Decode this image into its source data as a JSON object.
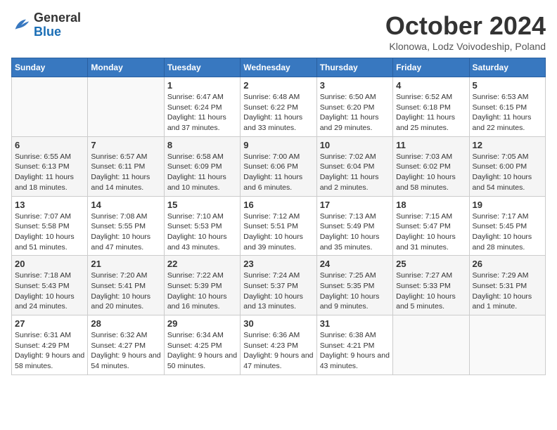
{
  "header": {
    "logo_general": "General",
    "logo_blue": "Blue",
    "month_title": "October 2024",
    "location": "Klonowa, Lodz Voivodeship, Poland"
  },
  "weekdays": [
    "Sunday",
    "Monday",
    "Tuesday",
    "Wednesday",
    "Thursday",
    "Friday",
    "Saturday"
  ],
  "weeks": [
    [
      {
        "day": "",
        "sunrise": "",
        "sunset": "",
        "daylight": ""
      },
      {
        "day": "",
        "sunrise": "",
        "sunset": "",
        "daylight": ""
      },
      {
        "day": "1",
        "sunrise": "Sunrise: 6:47 AM",
        "sunset": "Sunset: 6:24 PM",
        "daylight": "Daylight: 11 hours and 37 minutes."
      },
      {
        "day": "2",
        "sunrise": "Sunrise: 6:48 AM",
        "sunset": "Sunset: 6:22 PM",
        "daylight": "Daylight: 11 hours and 33 minutes."
      },
      {
        "day": "3",
        "sunrise": "Sunrise: 6:50 AM",
        "sunset": "Sunset: 6:20 PM",
        "daylight": "Daylight: 11 hours and 29 minutes."
      },
      {
        "day": "4",
        "sunrise": "Sunrise: 6:52 AM",
        "sunset": "Sunset: 6:18 PM",
        "daylight": "Daylight: 11 hours and 25 minutes."
      },
      {
        "day": "5",
        "sunrise": "Sunrise: 6:53 AM",
        "sunset": "Sunset: 6:15 PM",
        "daylight": "Daylight: 11 hours and 22 minutes."
      }
    ],
    [
      {
        "day": "6",
        "sunrise": "Sunrise: 6:55 AM",
        "sunset": "Sunset: 6:13 PM",
        "daylight": "Daylight: 11 hours and 18 minutes."
      },
      {
        "day": "7",
        "sunrise": "Sunrise: 6:57 AM",
        "sunset": "Sunset: 6:11 PM",
        "daylight": "Daylight: 11 hours and 14 minutes."
      },
      {
        "day": "8",
        "sunrise": "Sunrise: 6:58 AM",
        "sunset": "Sunset: 6:09 PM",
        "daylight": "Daylight: 11 hours and 10 minutes."
      },
      {
        "day": "9",
        "sunrise": "Sunrise: 7:00 AM",
        "sunset": "Sunset: 6:06 PM",
        "daylight": "Daylight: 11 hours and 6 minutes."
      },
      {
        "day": "10",
        "sunrise": "Sunrise: 7:02 AM",
        "sunset": "Sunset: 6:04 PM",
        "daylight": "Daylight: 11 hours and 2 minutes."
      },
      {
        "day": "11",
        "sunrise": "Sunrise: 7:03 AM",
        "sunset": "Sunset: 6:02 PM",
        "daylight": "Daylight: 10 hours and 58 minutes."
      },
      {
        "day": "12",
        "sunrise": "Sunrise: 7:05 AM",
        "sunset": "Sunset: 6:00 PM",
        "daylight": "Daylight: 10 hours and 54 minutes."
      }
    ],
    [
      {
        "day": "13",
        "sunrise": "Sunrise: 7:07 AM",
        "sunset": "Sunset: 5:58 PM",
        "daylight": "Daylight: 10 hours and 51 minutes."
      },
      {
        "day": "14",
        "sunrise": "Sunrise: 7:08 AM",
        "sunset": "Sunset: 5:55 PM",
        "daylight": "Daylight: 10 hours and 47 minutes."
      },
      {
        "day": "15",
        "sunrise": "Sunrise: 7:10 AM",
        "sunset": "Sunset: 5:53 PM",
        "daylight": "Daylight: 10 hours and 43 minutes."
      },
      {
        "day": "16",
        "sunrise": "Sunrise: 7:12 AM",
        "sunset": "Sunset: 5:51 PM",
        "daylight": "Daylight: 10 hours and 39 minutes."
      },
      {
        "day": "17",
        "sunrise": "Sunrise: 7:13 AM",
        "sunset": "Sunset: 5:49 PM",
        "daylight": "Daylight: 10 hours and 35 minutes."
      },
      {
        "day": "18",
        "sunrise": "Sunrise: 7:15 AM",
        "sunset": "Sunset: 5:47 PM",
        "daylight": "Daylight: 10 hours and 31 minutes."
      },
      {
        "day": "19",
        "sunrise": "Sunrise: 7:17 AM",
        "sunset": "Sunset: 5:45 PM",
        "daylight": "Daylight: 10 hours and 28 minutes."
      }
    ],
    [
      {
        "day": "20",
        "sunrise": "Sunrise: 7:18 AM",
        "sunset": "Sunset: 5:43 PM",
        "daylight": "Daylight: 10 hours and 24 minutes."
      },
      {
        "day": "21",
        "sunrise": "Sunrise: 7:20 AM",
        "sunset": "Sunset: 5:41 PM",
        "daylight": "Daylight: 10 hours and 20 minutes."
      },
      {
        "day": "22",
        "sunrise": "Sunrise: 7:22 AM",
        "sunset": "Sunset: 5:39 PM",
        "daylight": "Daylight: 10 hours and 16 minutes."
      },
      {
        "day": "23",
        "sunrise": "Sunrise: 7:24 AM",
        "sunset": "Sunset: 5:37 PM",
        "daylight": "Daylight: 10 hours and 13 minutes."
      },
      {
        "day": "24",
        "sunrise": "Sunrise: 7:25 AM",
        "sunset": "Sunset: 5:35 PM",
        "daylight": "Daylight: 10 hours and 9 minutes."
      },
      {
        "day": "25",
        "sunrise": "Sunrise: 7:27 AM",
        "sunset": "Sunset: 5:33 PM",
        "daylight": "Daylight: 10 hours and 5 minutes."
      },
      {
        "day": "26",
        "sunrise": "Sunrise: 7:29 AM",
        "sunset": "Sunset: 5:31 PM",
        "daylight": "Daylight: 10 hours and 1 minute."
      }
    ],
    [
      {
        "day": "27",
        "sunrise": "Sunrise: 6:31 AM",
        "sunset": "Sunset: 4:29 PM",
        "daylight": "Daylight: 9 hours and 58 minutes."
      },
      {
        "day": "28",
        "sunrise": "Sunrise: 6:32 AM",
        "sunset": "Sunset: 4:27 PM",
        "daylight": "Daylight: 9 hours and 54 minutes."
      },
      {
        "day": "29",
        "sunrise": "Sunrise: 6:34 AM",
        "sunset": "Sunset: 4:25 PM",
        "daylight": "Daylight: 9 hours and 50 minutes."
      },
      {
        "day": "30",
        "sunrise": "Sunrise: 6:36 AM",
        "sunset": "Sunset: 4:23 PM",
        "daylight": "Daylight: 9 hours and 47 minutes."
      },
      {
        "day": "31",
        "sunrise": "Sunrise: 6:38 AM",
        "sunset": "Sunset: 4:21 PM",
        "daylight": "Daylight: 9 hours and 43 minutes."
      },
      {
        "day": "",
        "sunrise": "",
        "sunset": "",
        "daylight": ""
      },
      {
        "day": "",
        "sunrise": "",
        "sunset": "",
        "daylight": ""
      }
    ]
  ]
}
